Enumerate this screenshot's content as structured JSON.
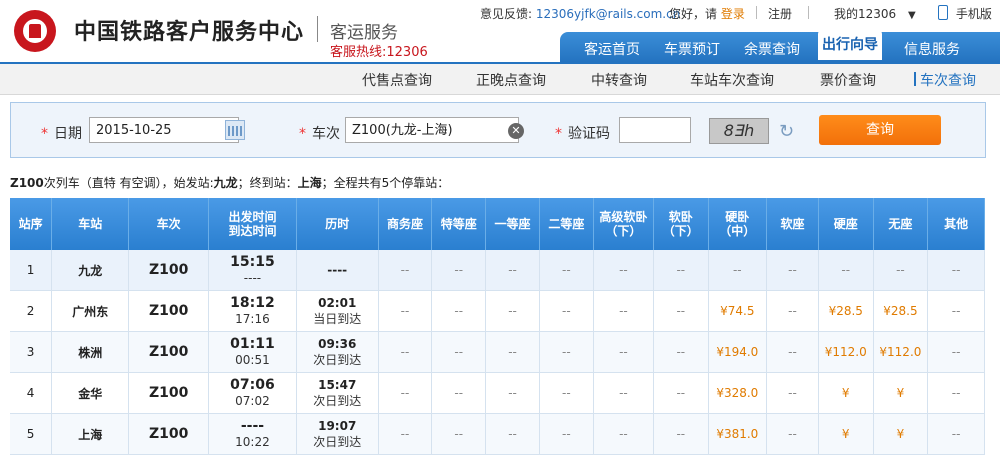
{
  "header": {
    "brand": "中国铁路客户服务中心",
    "sub": "客运服务",
    "hotline": "客服热线:12306",
    "feedback_label": "意见反馈:",
    "feedback_email": "12306yjfk@rails.com.cn",
    "greeting": "您好，请",
    "login": "登录",
    "register": "注册",
    "my12306": "我的12306",
    "mobile": "手机版"
  },
  "nav": [
    "客运首页",
    "车票预订",
    "余票查询",
    "出行向导",
    "信息服务"
  ],
  "nav_active": 3,
  "subnav": [
    "代售点查询",
    "正晚点查询",
    "中转查询",
    "车站车次查询",
    "票价查询",
    "车次查询"
  ],
  "query": {
    "date_label": "日期",
    "date_value": "2015-10-25",
    "train_label": "车次",
    "train_value": "Z100(九龙-上海)",
    "captcha_label": "验证码",
    "captcha_value": "",
    "captcha_image_text": "8Ǝh",
    "search_button": "查询"
  },
  "summary": {
    "train": "Z100",
    "text1": "次列车（直特 有空调），始发站:",
    "origin": "九龙",
    "text2": "；终到站：",
    "dest": "上海",
    "text3": "；全程共有5个停靠站："
  },
  "table": {
    "headers": [
      "站序",
      "车站",
      "车次",
      "出发时间\n到达时间",
      "历时",
      "商务座",
      "特等座",
      "一等座",
      "二等座",
      "高级软卧\n（下）",
      "软卧\n（下）",
      "硬卧\n（中）",
      "软座",
      "硬座",
      "无座",
      "其他"
    ],
    "rows": [
      {
        "seq": "1",
        "station": "九龙",
        "train": "Z100",
        "dep": "15:15",
        "arr": "----",
        "dur": "----",
        "dur_note": "",
        "prices": [
          "--",
          "--",
          "--",
          "--",
          "--",
          "--",
          "--",
          "--",
          "--",
          "--",
          "--"
        ]
      },
      {
        "seq": "2",
        "station": "广州东",
        "train": "Z100",
        "dep": "18:12",
        "arr": "17:16",
        "dur": "02:01",
        "dur_note": "当日到达",
        "prices": [
          "--",
          "--",
          "--",
          "--",
          "--",
          "--",
          "¥74.5",
          "--",
          "¥28.5",
          "¥28.5",
          "--"
        ]
      },
      {
        "seq": "3",
        "station": "株洲",
        "train": "Z100",
        "dep": "01:11",
        "arr": "00:51",
        "dur": "09:36",
        "dur_note": "次日到达",
        "prices": [
          "--",
          "--",
          "--",
          "--",
          "--",
          "--",
          "¥194.0",
          "--",
          "¥112.0",
          "¥112.0",
          "--"
        ]
      },
      {
        "seq": "4",
        "station": "金华",
        "train": "Z100",
        "dep": "07:06",
        "arr": "07:02",
        "dur": "15:47",
        "dur_note": "次日到达",
        "prices": [
          "--",
          "--",
          "--",
          "--",
          "--",
          "--",
          "¥328.0",
          "--",
          "¥",
          "¥",
          "--"
        ]
      },
      {
        "seq": "5",
        "station": "上海",
        "train": "Z100",
        "dep": "----",
        "arr": "10:22",
        "dur": "19:07",
        "dur_note": "次日到达",
        "prices": [
          "--",
          "--",
          "--",
          "--",
          "--",
          "--",
          "¥381.0",
          "--",
          "¥",
          "¥",
          "--"
        ]
      }
    ]
  }
}
